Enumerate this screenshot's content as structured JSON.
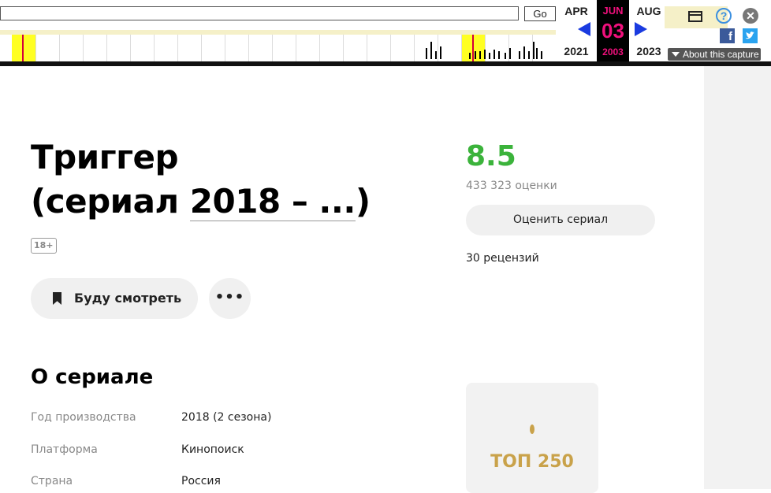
{
  "wayback": {
    "go_label": "Go",
    "url_value": "",
    "months": {
      "prev": {
        "month": "APR",
        "year": "2021"
      },
      "current": {
        "month": "JUN",
        "day": "03",
        "year": "2003"
      },
      "next": {
        "month": "AUG",
        "year": "2023"
      }
    },
    "about_label": "About this capture",
    "icons": [
      "window-icon",
      "help-icon",
      "close-icon",
      "facebook-icon",
      "twitter-icon"
    ],
    "colors": {
      "current": "#f0107c",
      "arrows": "#1a3be0",
      "year_highlight": "#ffff22"
    }
  },
  "show": {
    "title_line1": "Триггер",
    "title_prefix": "(сериал ",
    "title_years": "2018 – ...",
    "title_suffix": ")",
    "age_badge": "18+",
    "watch_label": "Буду смотреть",
    "more_label": "•••",
    "rating": "8.5",
    "votes": "433 323 оценки",
    "rate_label": "Оценить сериал",
    "reviews": "30 рецензий",
    "top250_label": "ТОП 250",
    "rating_color": "#3bb33b"
  },
  "about": {
    "heading": "О сериале",
    "rows": [
      {
        "key": "Год производства",
        "value": "2018 (2 сезона)"
      },
      {
        "key": "Платформа",
        "value": "Кинопоиск"
      },
      {
        "key": "Страна",
        "value": "Россия"
      }
    ]
  }
}
